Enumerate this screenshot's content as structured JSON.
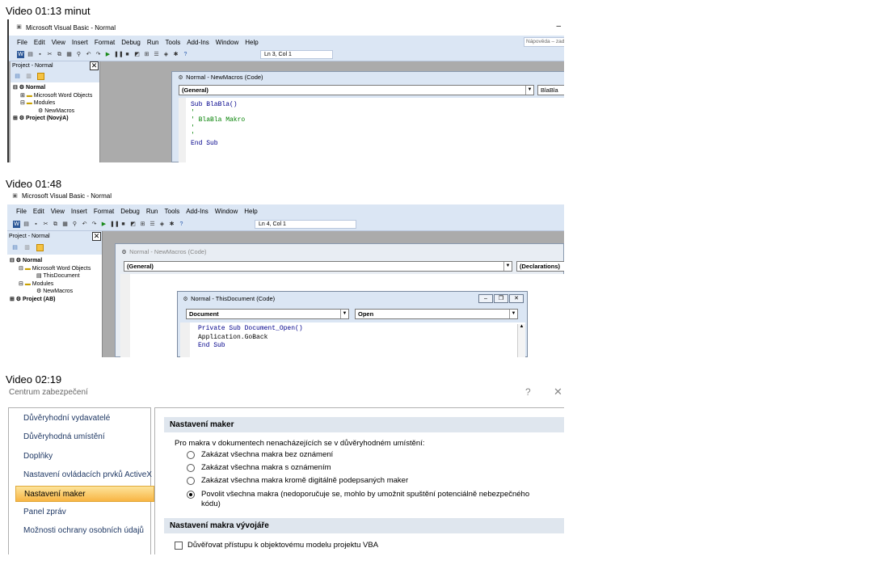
{
  "captions": [
    "Video 01:13 minut",
    "Video 01:48",
    "Video 02:19"
  ],
  "shot1": {
    "title": "Microsoft Visual Basic - Normal",
    "minimize": "–",
    "help_box": "Nápověda – zad",
    "menu": [
      "File",
      "Edit",
      "View",
      "Insert",
      "Format",
      "Debug",
      "Run",
      "Tools",
      "Add-Ins",
      "Window",
      "Help"
    ],
    "lncol": "Ln 3, Col 1",
    "project_title": "Project - Normal",
    "tree": [
      "Normal",
      "Microsoft Word Objects",
      "Modules",
      "NewMacros",
      "Project (NovýA)"
    ],
    "code_window_title": "Normal - NewMacros (Code)",
    "combo_left": "(General)",
    "combo_right": "BlaBla",
    "code": [
      "Sub BlaBla()",
      "'",
      "' BlaBla Makro",
      "'",
      "'",
      "End Sub"
    ]
  },
  "shot2": {
    "title": "Microsoft Visual Basic - Normal",
    "menu": [
      "File",
      "Edit",
      "View",
      "Insert",
      "Format",
      "Debug",
      "Run",
      "Tools",
      "Add-Ins",
      "Window",
      "Help"
    ],
    "lncol": "Ln 4, Col 1",
    "project_title": "Project - Normal",
    "tree": [
      "Normal",
      "Microsoft Word Objects",
      "ThisDocument",
      "Modules",
      "NewMacros",
      "Project (AB)"
    ],
    "back_window_title": "Normal - NewMacros (Code)",
    "back_combo_left": "(General)",
    "back_combo_right": "(Declarations)",
    "front_window_title": "Normal - ThisDocument (Code)",
    "front_combo_left": "Document",
    "front_combo_right": "Open",
    "code": [
      "Private Sub Document_Open()",
      "Application.GoBack",
      "End Sub"
    ]
  },
  "shot3": {
    "title": "Centrum zabezpečení",
    "help": "?",
    "close": "✕",
    "nav": [
      "Důvěryhodní vydavatelé",
      "Důvěryhodná umístění",
      "Doplňky",
      "Nastavení ovládacích prvků ActiveX",
      "Nastavení maker",
      "Panel zpráv",
      "Možnosti ochrany osobních údajů"
    ],
    "selected_nav": 4,
    "section1": "Nastavení maker",
    "intro": "Pro makra v dokumentech nenacházejících se v důvěryhodném umístění:",
    "options": [
      "Zakázat všechna makra bez oznámení",
      "Zakázat všechna makra s oznámením",
      "Zakázat všechna makra kromě digitálně podepsaných maker",
      "Povolit všechna makra (nedoporučuje se, mohlo by umožnit spuštění potenciálně nebezpečného"
    ],
    "option4_cont": "kódu)",
    "selected_option": 3,
    "section2": "Nastavení makra vývojáře",
    "checkbox_label": "Důvěřovat přístupu k objektovému modelu projektu VBA"
  },
  "colors": {
    "vbe_bg": "#dbe6f4",
    "gray_area": "#ababab",
    "code_kw": "#00008b",
    "code_comment": "#008000",
    "tc_header": "#dfe6ee",
    "tc_selected": "#f8b544"
  }
}
